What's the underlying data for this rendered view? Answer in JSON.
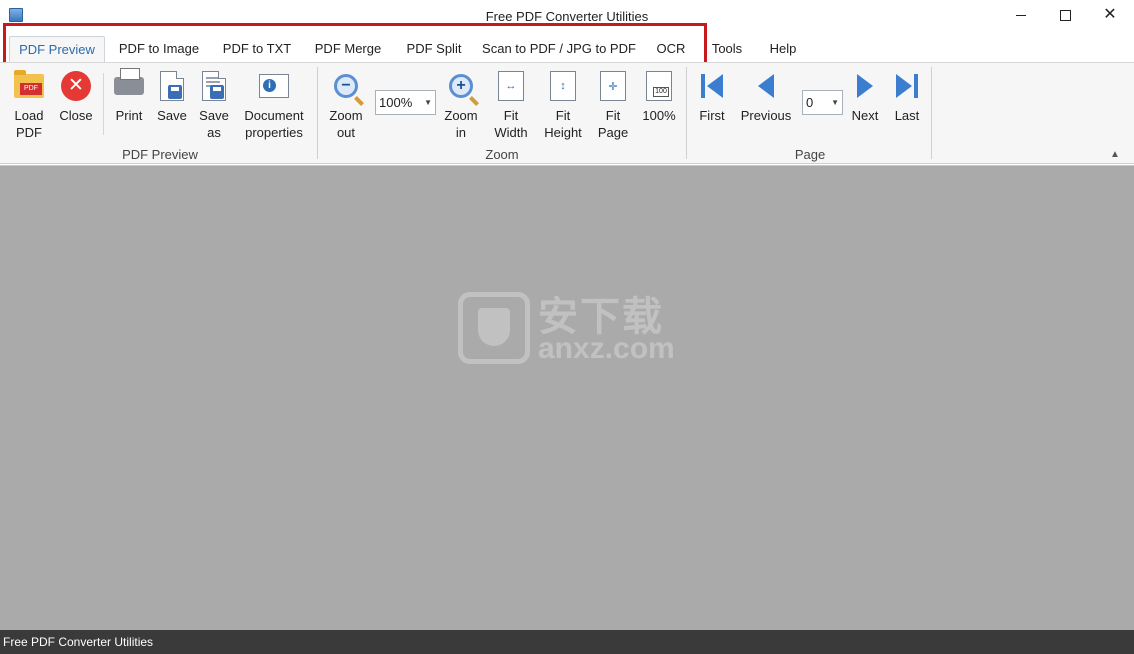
{
  "window": {
    "title": "Free PDF Converter Utilities"
  },
  "tabs": [
    {
      "label": "PDF Preview",
      "active": true
    },
    {
      "label": "PDF to Image"
    },
    {
      "label": "PDF to TXT"
    },
    {
      "label": "PDF Merge"
    },
    {
      "label": "PDF Split"
    },
    {
      "label": "Scan to PDF / JPG to PDF"
    },
    {
      "label": "OCR"
    },
    {
      "label": "Tools"
    },
    {
      "label": "Help"
    }
  ],
  "ribbon": {
    "pdf_preview_group": {
      "label": "PDF Preview",
      "load": "Load\nPDF",
      "load_l1": "Load",
      "load_l2": "PDF",
      "close": "Close",
      "print": "Print",
      "save": "Save",
      "saveas_l1": "Save",
      "saveas_l2": "as",
      "docprops_l1": "Document",
      "docprops_l2": "properties",
      "pdf_tag": "PDF"
    },
    "zoom_group": {
      "label": "Zoom",
      "zoom_value": "100%",
      "zoomout_l1": "Zoom",
      "zoomout_l2": "out",
      "zoomin_l1": "Zoom",
      "zoomin_l2": "in",
      "fitwidth_l1": "Fit",
      "fitwidth_l2": "Width",
      "fitheight_l1": "Fit",
      "fitheight_l2": "Height",
      "fitpage_l1": "Fit",
      "fitpage_l2": "Page",
      "actual": "100%",
      "actual_icon": "100"
    },
    "page_group": {
      "label": "Page",
      "first": "First",
      "previous": "Previous",
      "page_value": "0",
      "next": "Next",
      "last": "Last"
    }
  },
  "watermark": {
    "cn": "安下载",
    "en": "anxz.com"
  },
  "statusbar": {
    "text": "Free PDF Converter Utilities"
  },
  "colors": {
    "accent_tab": "#2b6cb0",
    "highlight": "#c8191b",
    "viewer_bg": "#aaaaaa",
    "statusbar_bg": "#3a3a3a"
  }
}
